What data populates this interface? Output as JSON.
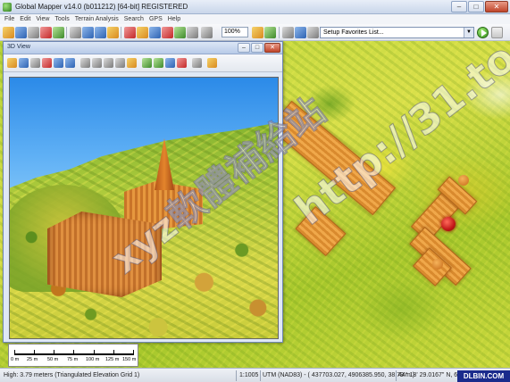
{
  "window": {
    "title": "Global Mapper v14.0 (b011212) [64-bit] REGISTERED",
    "minimize": "–",
    "maximize": "□",
    "close": "✕"
  },
  "menu": [
    "File",
    "Edit",
    "View",
    "Tools",
    "Terrain Analysis",
    "Search",
    "GPS",
    "Help"
  ],
  "toolbar": {
    "zoom_value": "100%",
    "favorites_placeholder": "Setup Favorites List...",
    "favorites_arrow": "▼"
  },
  "view3d": {
    "title": "3D View",
    "minimize": "–",
    "maximize": "□",
    "close": "✕"
  },
  "scale": {
    "labels": [
      "0 m",
      "25 m",
      "50 m",
      "75 m",
      "100 m",
      "125 m",
      "150 m"
    ]
  },
  "status": {
    "left": "High: 3.79 meters (Triangulated Elevation Grid 1)",
    "scale": "1:1005",
    "coords": "UTM (NAD83) - ( 437703.027, 4906385.950, 38.79 m )",
    "latlon": "44° 18' 29.0167\" N, 69° 46' 51.8631\" W"
  },
  "watermark": {
    "left": "xyz軟體補給站",
    "right": "http://31.to"
  },
  "badge": "DLBIN.COM"
}
